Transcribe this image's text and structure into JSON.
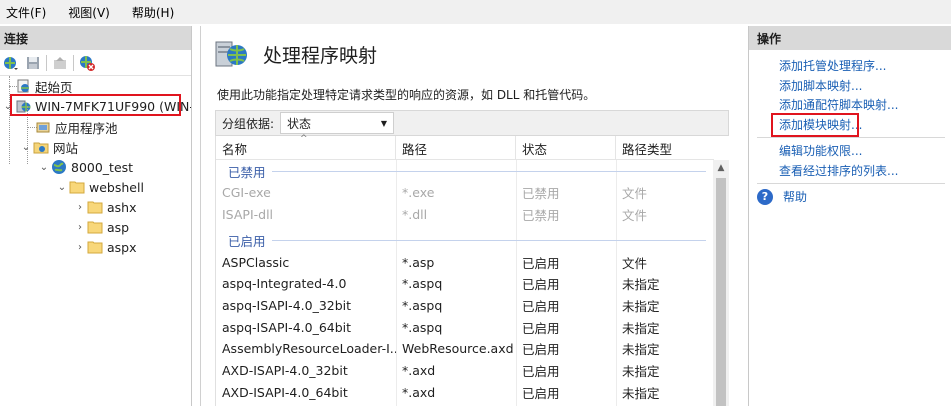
{
  "menubar": {
    "file": "文件(F)",
    "view": "视图(V)",
    "help": "帮助(H)"
  },
  "connections": {
    "header": "连接",
    "tree": {
      "start_page": "起始页",
      "server": "WIN-7MFK71UF990 (WIN-7",
      "app_pools": "应用程序池",
      "sites": "网站",
      "site": "8000_test",
      "webshell": "webshell",
      "ashx": "ashx",
      "asp": "asp",
      "aspx": "aspx"
    }
  },
  "main": {
    "title": "处理程序映射",
    "description": "使用此功能指定处理特定请求类型的响应的资源，如 DLL 和托管代码。",
    "group_by_label": "分组依据:",
    "group_by_value": "状态",
    "columns": {
      "name": "名称",
      "path": "路径",
      "state": "状态",
      "path_type": "路径类型"
    },
    "groups": {
      "disabled": "已禁用",
      "enabled": "已启用"
    },
    "disabled_rows": [
      {
        "name": "CGI-exe",
        "path": "*.exe",
        "state": "已禁用",
        "path_type": "文件"
      },
      {
        "name": "ISAPI-dll",
        "path": "*.dll",
        "state": "已禁用",
        "path_type": "文件"
      }
    ],
    "enabled_rows": [
      {
        "name": "ASPClassic",
        "path": "*.asp",
        "state": "已启用",
        "path_type": "文件"
      },
      {
        "name": "aspq-Integrated-4.0",
        "path": "*.aspq",
        "state": "已启用",
        "path_type": "未指定"
      },
      {
        "name": "aspq-ISAPI-4.0_32bit",
        "path": "*.aspq",
        "state": "已启用",
        "path_type": "未指定"
      },
      {
        "name": "aspq-ISAPI-4.0_64bit",
        "path": "*.aspq",
        "state": "已启用",
        "path_type": "未指定"
      },
      {
        "name": "AssemblyResourceLoader-I...",
        "path": "WebResource.axd",
        "state": "已启用",
        "path_type": "未指定"
      },
      {
        "name": "AXD-ISAPI-4.0_32bit",
        "path": "*.axd",
        "state": "已启用",
        "path_type": "未指定"
      },
      {
        "name": "AXD-ISAPI-4.0_64bit",
        "path": "*.axd",
        "state": "已启用",
        "path_type": "未指定"
      }
    ]
  },
  "actions": {
    "header": "操作",
    "add_managed_handler": "添加托管处理程序...",
    "add_script_map": "添加脚本映射...",
    "add_wildcard_script_map": "添加通配符脚本映射...",
    "add_module_mapping": "添加模块映射...",
    "edit_feature_permissions": "编辑功能权限...",
    "view_ordered_list": "查看经过排序的列表...",
    "help": "帮助"
  },
  "colors": {
    "link": "#1a5fb4",
    "highlight_box": "#e0141e",
    "group_text": "#3a5ea8"
  }
}
